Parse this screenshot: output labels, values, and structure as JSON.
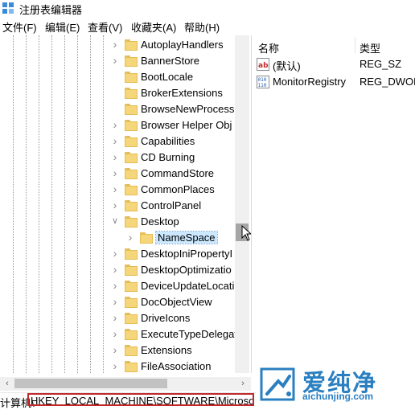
{
  "window": {
    "title": "注册表编辑器",
    "icon": "regedit-icon"
  },
  "menu": [
    {
      "label": "文件(F)"
    },
    {
      "label": "编辑(E)"
    },
    {
      "label": "查看(V)"
    },
    {
      "label": "收藏夹(A)"
    },
    {
      "label": "帮助(H)"
    }
  ],
  "tree": {
    "items": [
      {
        "label": "AutoplayHandlers",
        "expander": "collapsed"
      },
      {
        "label": "BannerStore",
        "expander": "collapsed"
      },
      {
        "label": "BootLocale",
        "expander": "none"
      },
      {
        "label": "BrokerExtensions",
        "expander": "none"
      },
      {
        "label": "BrowseNewProcess",
        "expander": "none"
      },
      {
        "label": "Browser Helper Obj",
        "expander": "collapsed"
      },
      {
        "label": "Capabilities",
        "expander": "collapsed"
      },
      {
        "label": "CD Burning",
        "expander": "collapsed"
      },
      {
        "label": "CommandStore",
        "expander": "collapsed"
      },
      {
        "label": "CommonPlaces",
        "expander": "collapsed"
      },
      {
        "label": "ControlPanel",
        "expander": "collapsed"
      },
      {
        "label": "Desktop",
        "expander": "expanded"
      },
      {
        "label": "NameSpace",
        "expander": "collapsed",
        "selected": true,
        "child": true
      },
      {
        "label": "DesktopIniPropertyI",
        "expander": "collapsed"
      },
      {
        "label": "DesktopOptimizatio",
        "expander": "collapsed"
      },
      {
        "label": "DeviceUpdateLocati",
        "expander": "collapsed"
      },
      {
        "label": "DocObjectView",
        "expander": "collapsed"
      },
      {
        "label": "DriveIcons",
        "expander": "collapsed"
      },
      {
        "label": "ExecuteTypeDelegat",
        "expander": "collapsed"
      },
      {
        "label": "Extensions",
        "expander": "collapsed"
      },
      {
        "label": "FileAssociation",
        "expander": "collapsed"
      }
    ]
  },
  "list": {
    "headers": {
      "name": "名称",
      "type": "类型"
    },
    "rows": [
      {
        "name": "(默认)",
        "type": "REG_SZ",
        "icon": "string-value-icon"
      },
      {
        "name": "MonitorRegistry",
        "type": "REG_DWOR",
        "icon": "binary-value-icon"
      }
    ]
  },
  "statusbar": {
    "prefix": "计算机\\",
    "path": "HKEY_LOCAL_MACHINE\\SOFTWARE\\Microsoft\\"
  },
  "watermark": {
    "title": "爱纯净",
    "url": "aichunjing.com"
  },
  "colors": {
    "highlight": "#c0282a",
    "selection": "#cce8ff",
    "folder": "#f6d67a",
    "brand": "#2a7fc0"
  }
}
